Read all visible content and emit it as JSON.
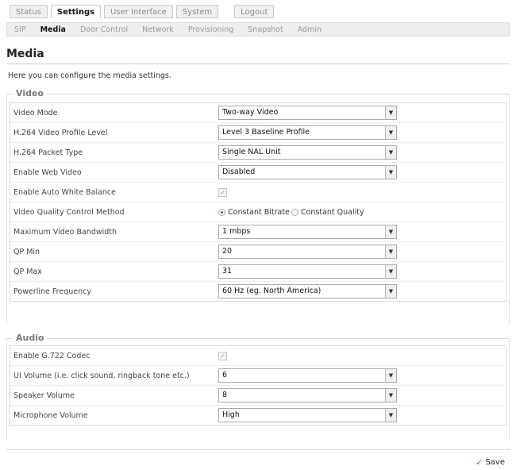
{
  "top_tabs": {
    "status": "Status",
    "settings": "Settings",
    "user_interface": "User Interface",
    "system": "System",
    "logout": "Logout"
  },
  "sub_nav": {
    "sip": "SIP",
    "media": "Media",
    "door_control": "Door Control",
    "network": "Network",
    "provisioning": "Provisioning",
    "snapshot": "Snapshot",
    "admin": "Admin"
  },
  "page": {
    "title": "Media",
    "intro": "Here you can configure the media settings."
  },
  "video": {
    "legend": "Video",
    "video_mode": {
      "label": "Video Mode",
      "value": "Two-way Video"
    },
    "profile_level": {
      "label": "H.264 Video Profile Level",
      "value": "Level 3 Baseline Profile"
    },
    "packet_type": {
      "label": "H.264 Packet Type",
      "value": "Single NAL Unit"
    },
    "web_video": {
      "label": "Enable Web Video",
      "value": "Disabled"
    },
    "auto_white_balance": {
      "label": "Enable Auto White Balance",
      "checked": true
    },
    "quality_control": {
      "label": "Video Quality Control Method",
      "option1": "Constant Bitrate",
      "option2": "Constant Quality",
      "selected": "Constant Bitrate"
    },
    "max_bandwidth": {
      "label": "Maximum Video Bandwidth",
      "value": "1 mbps"
    },
    "qp_min": {
      "label": "QP Min",
      "value": "20"
    },
    "qp_max": {
      "label": "QP Max",
      "value": "31"
    },
    "powerline": {
      "label": "Powerline Frequency",
      "value": "60 Hz (eg. North America)"
    }
  },
  "audio": {
    "legend": "Audio",
    "g722": {
      "label": "Enable G.722 Codec",
      "checked": true
    },
    "ui_volume": {
      "label": "UI Volume (i.e. click sound, ringback tone etc.)",
      "value": "6"
    },
    "speaker_volume": {
      "label": "Speaker Volume",
      "value": "8"
    },
    "microphone_volume": {
      "label": "Microphone Volume",
      "value": "High"
    }
  },
  "footer": {
    "save_label": "Save"
  },
  "icons": {
    "checkmark": "✓",
    "dropdown_arrow": "▼"
  },
  "colors": {
    "save_check": "#2f9c2f",
    "radio_selected": "#2b6ab9"
  }
}
